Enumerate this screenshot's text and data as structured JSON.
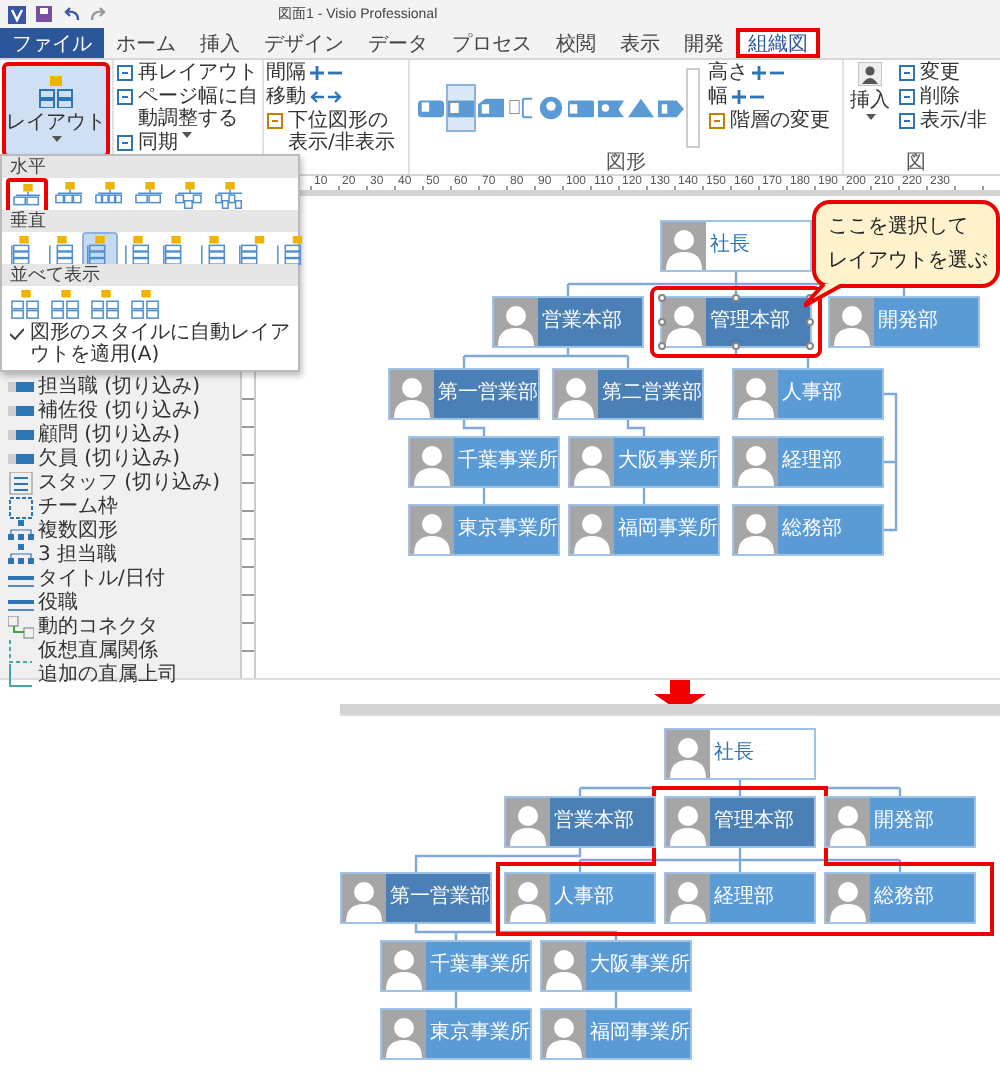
{
  "window": {
    "title": "図面1 - Visio Professional"
  },
  "tabs": [
    {
      "label": "ファイル",
      "kind": "file",
      "selected": false
    },
    {
      "label": "ホーム",
      "kind": "tab",
      "selected": false
    },
    {
      "label": "挿入",
      "kind": "tab",
      "selected": false
    },
    {
      "label": "デザイン",
      "kind": "tab",
      "selected": false
    },
    {
      "label": "データ",
      "kind": "tab",
      "selected": false
    },
    {
      "label": "プロセス",
      "kind": "tab",
      "selected": false
    },
    {
      "label": "校閲",
      "kind": "tab",
      "selected": false
    },
    {
      "label": "表示",
      "kind": "tab",
      "selected": false
    },
    {
      "label": "開発",
      "kind": "tab",
      "selected": false
    },
    {
      "label": "組織図",
      "kind": "tab",
      "selected": true
    }
  ],
  "ribbon": {
    "layout_button": {
      "label": "レイアウト",
      "highlighted": true
    },
    "layout_commands": [
      "再レイアウト",
      "ページ幅に自動調整する",
      "同期"
    ],
    "spacing": [
      {
        "label": "間隔",
        "kind": "plus-minus"
      },
      {
        "label": "移動",
        "kind": "arrows"
      }
    ],
    "toggle_subordinates": "下位図形の表示/非表示",
    "shape_styles": [
      {
        "kind": "wide",
        "selected": false
      },
      {
        "kind": "framed",
        "selected": true
      },
      {
        "kind": "tab",
        "selected": false
      },
      {
        "kind": "bracket",
        "selected": false
      },
      {
        "kind": "circle",
        "selected": false
      },
      {
        "kind": "card",
        "selected": false
      },
      {
        "kind": "flag",
        "selected": false
      },
      {
        "kind": "triangle",
        "selected": false
      },
      {
        "kind": "pentagon",
        "selected": false
      }
    ],
    "size": [
      {
        "label": "高さ"
      },
      {
        "label": "幅"
      }
    ],
    "level_change": "階層の変更",
    "shapes_group": "図形",
    "insert": "挿入",
    "picture_commands": [
      "変更",
      "削除",
      "表示/非"
    ],
    "picture_group": "図"
  },
  "ruler_labels": [
    "10",
    "20",
    "30",
    "40",
    "50",
    "60",
    "70",
    "80",
    "90",
    "100",
    "110",
    "120",
    "130",
    "140",
    "150",
    "160",
    "170",
    "180",
    "190",
    "200",
    "210",
    "220",
    "230"
  ],
  "layout_menu": {
    "sections": [
      {
        "title": "水平",
        "kind": "horizontal",
        "options": [
          {
            "selected": false,
            "highlighted": true
          },
          {
            "selected": false,
            "highlighted": false
          },
          {
            "selected": false,
            "highlighted": false
          },
          {
            "selected": false,
            "highlighted": false
          },
          {
            "selected": false,
            "highlighted": false
          },
          {
            "selected": false,
            "highlighted": false
          }
        ]
      },
      {
        "title": "垂直",
        "kind": "vertical",
        "options": [
          {
            "selected": false,
            "highlighted": false
          },
          {
            "selected": false,
            "highlighted": false
          },
          {
            "selected": true,
            "highlighted": false
          },
          {
            "selected": false,
            "highlighted": false
          },
          {
            "selected": false,
            "highlighted": false
          },
          {
            "selected": false,
            "highlighted": false
          },
          {
            "selected": false,
            "highlighted": false
          },
          {
            "selected": false,
            "highlighted": false
          }
        ]
      },
      {
        "title": "並べて表示",
        "kind": "tiled",
        "options": [
          {
            "selected": false,
            "highlighted": false
          },
          {
            "selected": false,
            "highlighted": false
          },
          {
            "selected": false,
            "highlighted": false
          },
          {
            "selected": false,
            "highlighted": false
          }
        ]
      }
    ],
    "apply_style": {
      "label": "図形のスタイルに自動レイアウトを適用(A)",
      "checked": true
    }
  },
  "stencil": [
    {
      "label": "担当職 (切り込み)",
      "kind": "bar"
    },
    {
      "label": "補佐役 (切り込み)",
      "kind": "bar"
    },
    {
      "label": "顧問 (切り込み)",
      "kind": "bar"
    },
    {
      "label": "欠員 (切り込み)",
      "kind": "bar"
    },
    {
      "label": "スタッフ (切り込み)",
      "kind": "staff"
    },
    {
      "label": "チーム枠",
      "kind": "team"
    },
    {
      "label": "複数図形",
      "kind": "multi"
    },
    {
      "label": "3 担当職",
      "kind": "multi"
    },
    {
      "label": "タイトル/日付",
      "kind": "title"
    },
    {
      "label": "役職",
      "kind": "title"
    },
    {
      "label": "動的コネクタ",
      "kind": "connector"
    },
    {
      "label": "仮想直属関係",
      "kind": "dotted"
    },
    {
      "label": "追加の直属上司",
      "kind": "corner"
    }
  ],
  "callout": [
    "ここを選択して",
    "レイアウトを選ぶ"
  ],
  "before": [
    {
      "label": "社長",
      "kind": "white",
      "selected": false
    },
    {
      "label": "営業本部",
      "kind": "dark",
      "selected": false
    },
    {
      "label": "管理本部",
      "kind": "dark",
      "selected": true
    },
    {
      "label": "開発部",
      "kind": "light",
      "selected": false
    },
    {
      "label": "第一営業部",
      "kind": "dark",
      "selected": false
    },
    {
      "label": "第二営業部",
      "kind": "dark",
      "selected": false
    },
    {
      "label": "人事部",
      "kind": "light",
      "selected": false
    },
    {
      "label": "千葉事業所",
      "kind": "light",
      "selected": false
    },
    {
      "label": "大阪事業所",
      "kind": "light",
      "selected": false
    },
    {
      "label": "経理部",
      "kind": "light",
      "selected": false
    },
    {
      "label": "東京事業所",
      "kind": "light",
      "selected": false
    },
    {
      "label": "福岡事業所",
      "kind": "light",
      "selected": false
    },
    {
      "label": "総務部",
      "kind": "light",
      "selected": false
    }
  ],
  "after": [
    {
      "label": "社長",
      "kind": "white"
    },
    {
      "label": "営業本部",
      "kind": "dark"
    },
    {
      "label": "管理本部",
      "kind": "dark"
    },
    {
      "label": "開発部",
      "kind": "light"
    },
    {
      "label": "第一営業部",
      "kind": "dark"
    },
    {
      "label": "人事部",
      "kind": "light"
    },
    {
      "label": "経理部",
      "kind": "light"
    },
    {
      "label": "総務部",
      "kind": "light"
    },
    {
      "label": "千葉事業所",
      "kind": "light"
    },
    {
      "label": "大阪事業所",
      "kind": "light"
    },
    {
      "label": "東京事業所",
      "kind": "light"
    },
    {
      "label": "福岡事業所",
      "kind": "light"
    }
  ]
}
